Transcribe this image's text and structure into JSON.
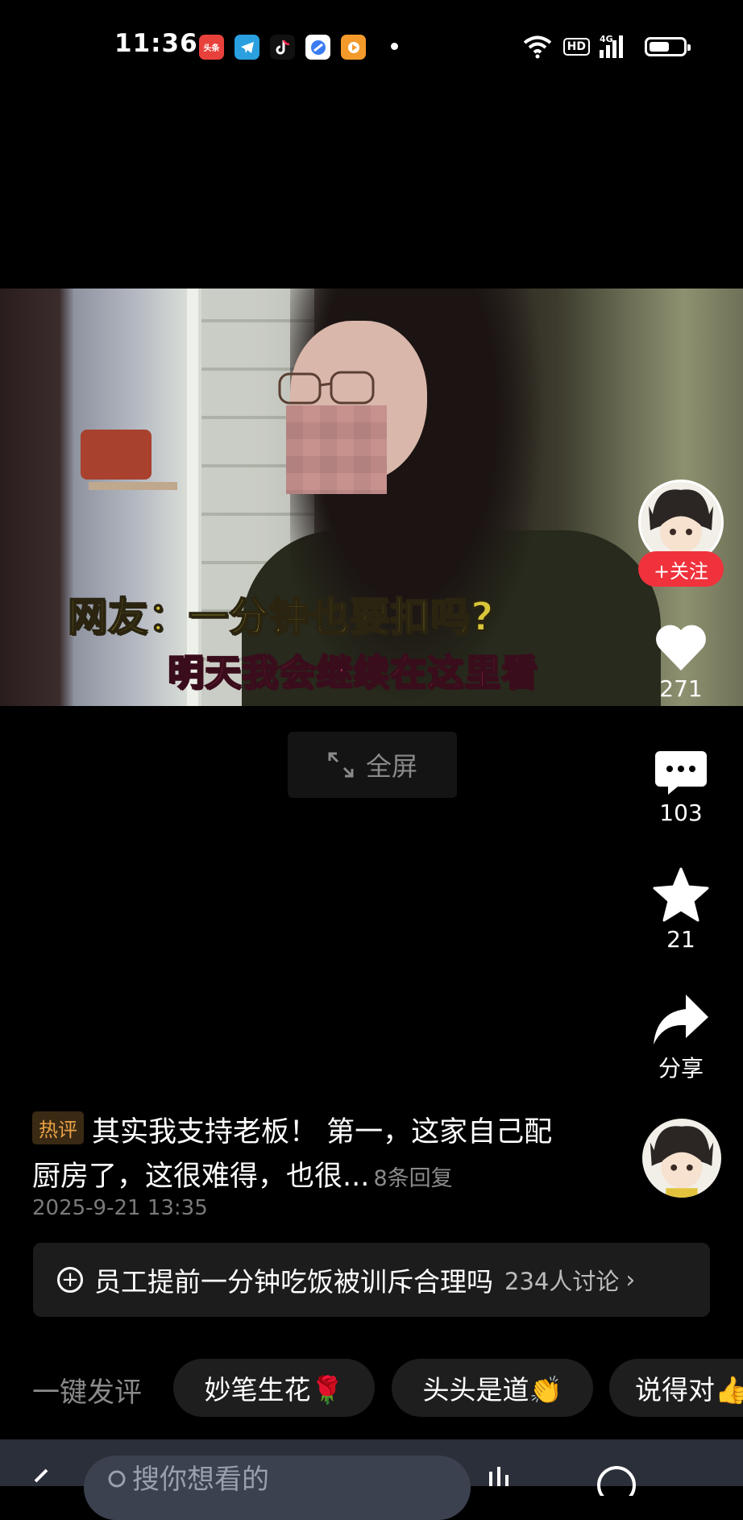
{
  "status_bar": {
    "time": "11:36",
    "apps": [
      {
        "name": "toutiao-app-icon",
        "label": "头条",
        "color": "#e8413b"
      },
      {
        "name": "telegram-app-icon",
        "label": "",
        "color": "#2aa0e0"
      },
      {
        "name": "tiktok-app-icon",
        "label": "",
        "color": "#111111"
      },
      {
        "name": "browser-app-icon",
        "label": "",
        "color": "#3a7cf0"
      },
      {
        "name": "video-app-icon",
        "label": "",
        "color": "#f39a2b"
      }
    ],
    "hd_label": "HD",
    "network_label": "4G"
  },
  "video": {
    "caption_top": "网友：一分钟也要扣吗?",
    "caption_bottom": "明天我会继续在这里看"
  },
  "fullscreen": {
    "label": "全屏"
  },
  "author": {
    "follow_label": "+关注"
  },
  "actions": {
    "likes": "271",
    "comments": "103",
    "favorites": "21",
    "share_label": "分享"
  },
  "hot_comment": {
    "badge": "热评",
    "text": "其实我支持老板！ 第一，这家自己配厨房了，这很难得，也很...",
    "replies": "8条回复",
    "time": "2025-9-21 13:35"
  },
  "topic": {
    "title": "员工提前一分钟吃饭被训斥合理吗",
    "count": "234人讨论"
  },
  "quick_comment": {
    "label": "一键发评",
    "chips": [
      "妙笔生花🌹",
      "头头是道👏",
      "说得对👍"
    ]
  },
  "bottom_bar": {
    "search_placeholder": "搜你想看的"
  },
  "colors": {
    "follow_red": "#f0323c",
    "hot_badge_text": "#e9a246",
    "caption_yellow": "#d9c63a",
    "caption_pink": "#ea4a7a"
  }
}
